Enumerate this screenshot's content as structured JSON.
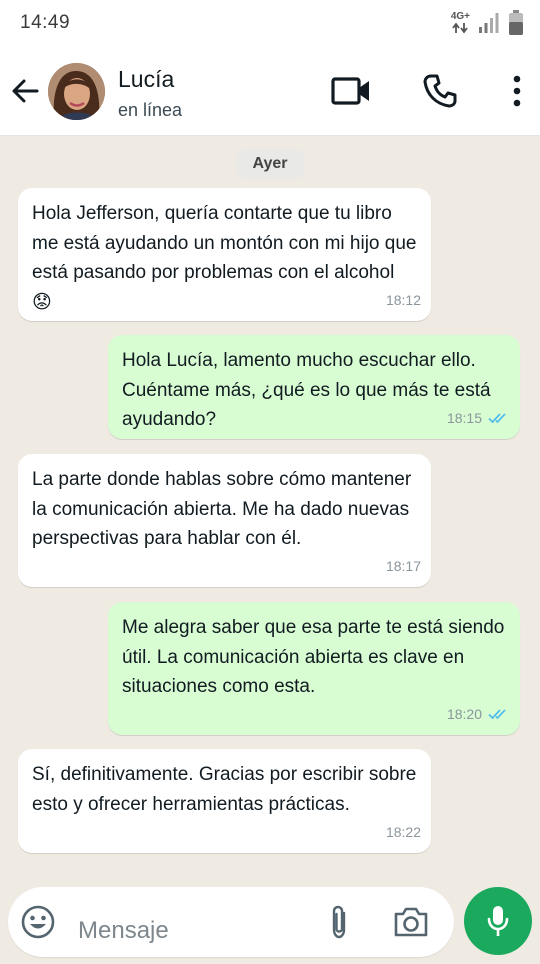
{
  "status_bar": {
    "time": "14:49",
    "network": "4G+"
  },
  "header": {
    "contact_name": "Lucía",
    "contact_status": "en línea"
  },
  "chat": {
    "date_label": "Ayer",
    "messages": [
      {
        "direction": "in",
        "text": "Hola Jefferson, quería contarte que tu libro me está ayudando un montón con mi hijo que está pasando por problemas con el alcohol",
        "emoji": "😟",
        "time": "18:12"
      },
      {
        "direction": "out",
        "text": "Hola Lucía, lamento mucho escuchar ello. Cuéntame más, ¿qué es lo que más te está ayudando?",
        "time": "18:15",
        "read": true
      },
      {
        "direction": "in",
        "text": "La parte donde hablas sobre cómo mantener la comunicación abierta. Me ha dado nuevas perspectivas para hablar con él.",
        "time": "18:17"
      },
      {
        "direction": "out",
        "text": "Me alegra saber que esa parte te está siendo útil. La comunicación abierta es clave en situaciones como esta.",
        "time": "18:20",
        "read": true
      },
      {
        "direction": "in",
        "text": "Sí, definitivamente. Gracias por escribir sobre esto y ofrecer herramientas prácticas.",
        "time": "18:22"
      }
    ]
  },
  "input": {
    "placeholder": "Mensaje"
  },
  "colors": {
    "chat_background": "#efeae2",
    "incoming_bubble": "#ffffff",
    "outgoing_bubble": "#d9fdd3",
    "read_ticks": "#53bdeb",
    "accent_green": "#1aa95d"
  },
  "icons": {
    "back": "arrow-left-icon",
    "video_call": "video-camera-icon",
    "voice_call": "phone-icon",
    "menu": "more-vertical-icon",
    "emoji": "smiley-icon",
    "attach": "paperclip-icon",
    "camera": "camera-icon",
    "mic": "microphone-icon"
  }
}
